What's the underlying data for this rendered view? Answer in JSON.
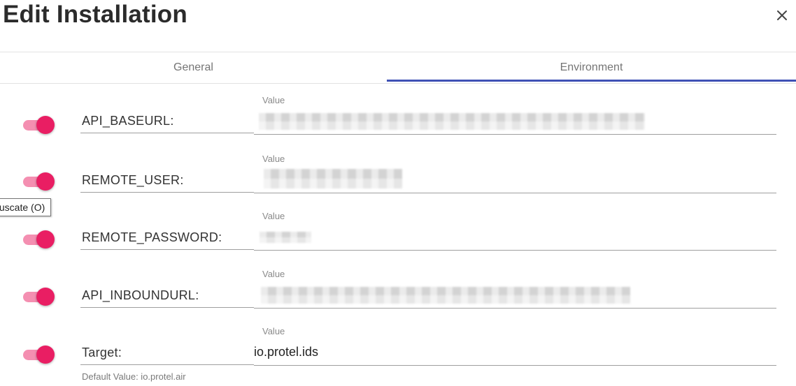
{
  "dialog": {
    "title": "Edit Installation",
    "close_icon": "close-icon"
  },
  "tabs": [
    {
      "label": "General",
      "active": false
    },
    {
      "label": "Environment",
      "active": true
    }
  ],
  "colors": {
    "accent": "#3f51b5",
    "toggle_thumb": "#e91e63",
    "toggle_track": "#f48fb1"
  },
  "variables": [
    {
      "name": "API_BASEURL:",
      "caption": "Value",
      "value": "",
      "obfuscate": true
    },
    {
      "name": "REMOTE_USER:",
      "caption": "Value",
      "value": "",
      "obfuscate": true
    },
    {
      "name": "REMOTE_PASSWORD:",
      "caption": "Value",
      "value": "",
      "obfuscate": true
    },
    {
      "name": "API_INBOUNDURL:",
      "caption": "Value",
      "value": "",
      "obfuscate": true
    },
    {
      "name": "Target:",
      "caption": "Value",
      "value": "io.protel.ids",
      "obfuscate": true
    }
  ],
  "tooltip": "fuscate (O)",
  "default_hint": "Default Value: io.protel.air"
}
